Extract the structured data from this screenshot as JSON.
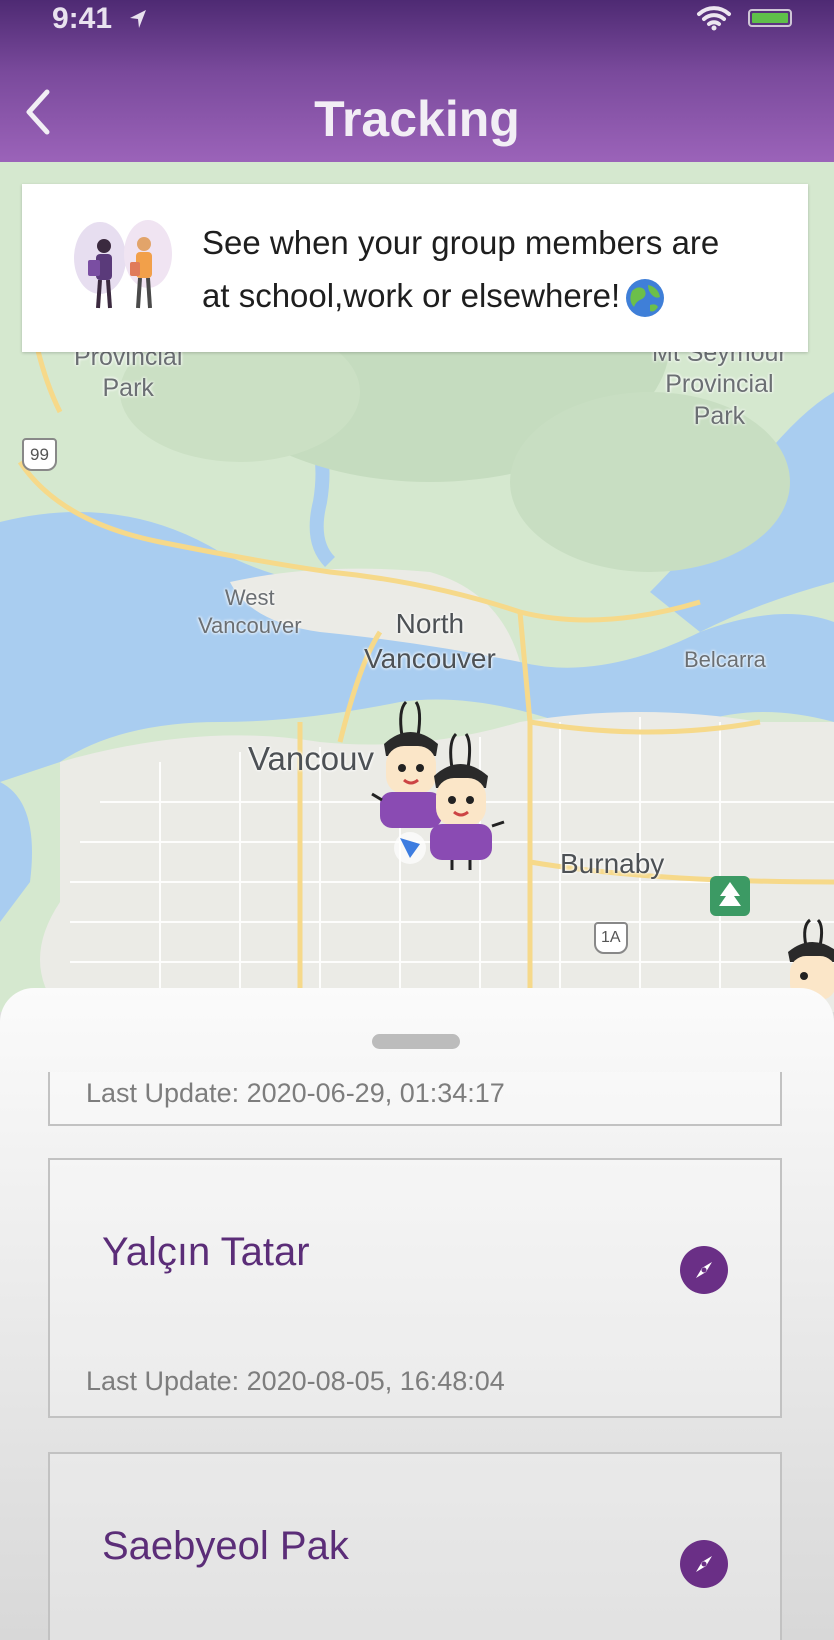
{
  "status_bar": {
    "time": "9:41",
    "location_arrow_icon": "location-arrow-icon",
    "wifi_icon": "wifi-icon",
    "battery_icon": "battery-charging-icon"
  },
  "header": {
    "title": "Tracking",
    "back_icon": "chevron-left-icon",
    "colors": {
      "top": "#4e2a73",
      "bottom": "#9b63b9"
    }
  },
  "banner": {
    "line1": "See when your group members are",
    "line2": "at school,work or elsewhere!",
    "globe_icon": "globe-icon",
    "illustration": "people-illustration"
  },
  "map": {
    "labels": [
      "Provincial\nPark",
      "Mt Seymour\nProvincial\nPark",
      "99",
      "West\nVancouver",
      "North\nVancouver",
      "Belcarra",
      "Vancouv",
      "Burnaby",
      "1A"
    ]
  },
  "sheet": {
    "handle": "drag-handle",
    "members": [
      {
        "name": "",
        "last_update": "Last Update: 2020-06-29, 01:34:17"
      },
      {
        "name": "Yalçın Tatar",
        "last_update": "Last Update: 2020-08-05, 16:48:04"
      },
      {
        "name": "Saebyeol Pak",
        "last_update": ""
      }
    ],
    "action_icon": "compass-icon",
    "accent_color": "#6a2f86"
  }
}
